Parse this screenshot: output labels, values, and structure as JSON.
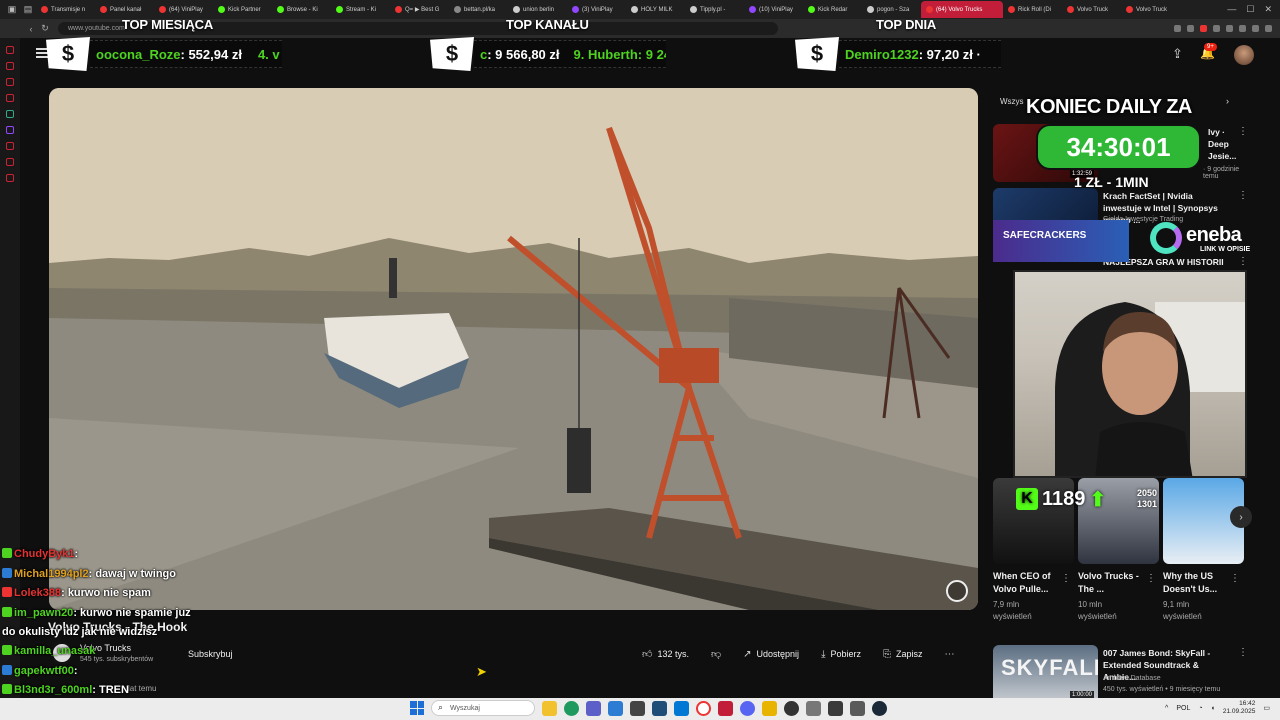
{
  "browser": {
    "tabs": [
      {
        "label": "Transmisje n",
        "color": "#e33"
      },
      {
        "label": "Panel kanał",
        "color": "#e33"
      },
      {
        "label": "(64) ViniPlay",
        "color": "#e33"
      },
      {
        "label": "Kick Partner",
        "color": "#53fc18"
      },
      {
        "label": "Browse - Ki",
        "color": "#53fc18"
      },
      {
        "label": "Stream - Ki",
        "color": "#53fc18"
      },
      {
        "label": "Q= ▶ Best G",
        "color": "#e33"
      },
      {
        "label": "bettan.pl/ka",
        "color": "#888"
      },
      {
        "label": "union berlin",
        "color": "#ccc"
      },
      {
        "label": "(3) ViniPlay",
        "color": "#9146ff"
      },
      {
        "label": "HOLY MILK",
        "color": "#ccc"
      },
      {
        "label": "Tipply.pl -",
        "color": "#ccc"
      },
      {
        "label": "(10) ViniPlay",
        "color": "#9146ff"
      },
      {
        "label": "Kick Redar",
        "color": "#53fc18"
      },
      {
        "label": "pogon - Sza",
        "color": "#ccc"
      },
      {
        "label": "(64) Volvo Trucks",
        "color": "#e33",
        "active": true
      },
      {
        "label": "Rick Roll (Di",
        "color": "#e33"
      },
      {
        "label": "Volvo Truck",
        "color": "#e33"
      },
      {
        "label": "Volvo Truck",
        "color": "#e33"
      }
    ],
    "url": "www.youtube.com"
  },
  "overlay": {
    "top_month_title": "TOP MIESIĄCA",
    "top_channel_title": "TOP KANAŁU",
    "top_day_title": "TOP DNIA",
    "dollar": "$",
    "top_month": {
      "name": "oocona_Roze",
      "amount": ": 552,94 zł",
      "next": "4. v"
    },
    "top_channel": {
      "name": "c",
      "amount": ": 9 566,80 zł",
      "next": "9. Huberth: 9 24"
    },
    "top_day": {
      "name": "Demiro1232",
      "amount": ": 97,20 zł ·"
    },
    "countdown_title": "KONIEC DAILY ZA",
    "countdown": "34:30:01",
    "rate": "1 ZŁ - 1MIN",
    "eneba_banner": "SAFECRACKERS",
    "eneba": "eneba",
    "eneba_sub": "LINK W OPISIE",
    "kick_viewers": "1189",
    "kick_stat_1": "2050",
    "kick_stat_2": "1301"
  },
  "header": {
    "notifications": "9+"
  },
  "video": {
    "title": "Volvo Trucks - The Hook",
    "channel": "Volvo Trucks",
    "subscribers": "545 tys. subskrybentów",
    "subscribe": "Subskrybuj",
    "likes": "132 tys.",
    "share": "Udostępnij",
    "download": "Pobierz",
    "save": "Zapisz",
    "age": "lat temu"
  },
  "sidebar": {
    "chip": "Wszys",
    "recs": [
      {
        "title": "Ivy · Deep Jesie...",
        "channel": "",
        "meta": "· 9 godzinie temu",
        "duration": "1:32:59"
      },
      {
        "title": "Krach FactSet | Nvidia inwestuje w Intel | Synopsys mocno ...",
        "channel": "Giełda Inwestycje Trading",
        "meta": "",
        "duration": ""
      },
      {
        "title": "NAJLEPSZA GRA W HISTORII",
        "channel": "",
        "meta": "",
        "duration": ""
      }
    ],
    "shorts": [
      {
        "title": "When CEO of Volvo Pulle...",
        "views": "7,9 mln wyświetleń"
      },
      {
        "title": "Volvo Trucks - The ...",
        "views": "10 mln wyświetleń"
      },
      {
        "title": "Why the US Doesn't Us...",
        "views": "9,1 mln wyświetleń"
      }
    ],
    "bottom_rec": {
      "title": "007 James Bond: SkyFall - Extended Soundtrack & Ambie...",
      "channel": "Ambient Database",
      "meta": "450 tys. wyświetleń • 9 miesięcy temu",
      "duration": "1:00:00",
      "thumb_text": "SKYFALL"
    }
  },
  "chat": [
    {
      "user": "ChudyByk1",
      "msg": ":",
      "color": "#e53232"
    },
    {
      "user": "Michal1994pl2",
      "msg": ": dawaj w twingo",
      "color": "#e0a020"
    },
    {
      "user": "Lolek388",
      "msg": ": kurwo nie spam",
      "color": "#e53232"
    },
    {
      "user": "im_pawn20",
      "msg": ": kurwo nie spamie juz",
      "color": "#4fd321"
    },
    {
      "user": "",
      "msg": "do okulisty idz jak nie widzisz",
      "color": "#fff"
    },
    {
      "user": "kamilla_unasak",
      "msg": "",
      "color": "#4fd321"
    },
    {
      "user": "gapekwtf00",
      "msg": ":",
      "color": "#4fd321"
    },
    {
      "user": "Bl3nd3r_600ml",
      "msg": ": TREN",
      "color": "#4fd321"
    },
    {
      "user": "Michal1994pl2",
      "msg": ":",
      "color": "#e0a020"
    }
  ],
  "taskbar": {
    "search": "Wyszukaj",
    "time": "16:42",
    "date": "21.09.2025",
    "lang": "POL"
  }
}
